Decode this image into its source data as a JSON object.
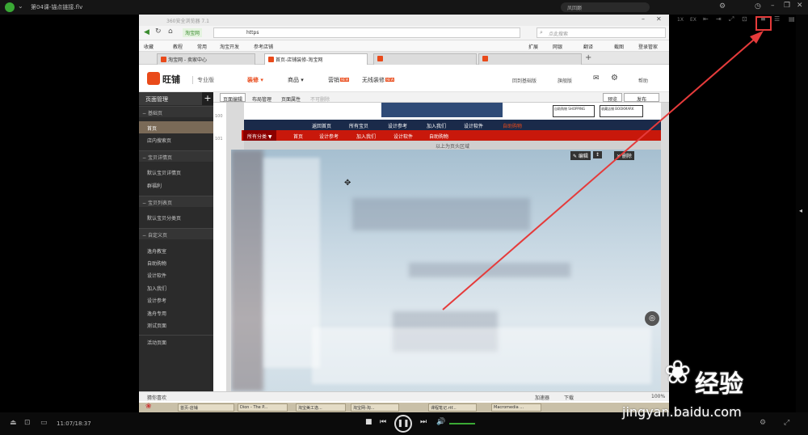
{
  "player": {
    "title": "第04课-锚点链接.flv",
    "search_label": "凤回巅",
    "time": "11:07/18:37"
  },
  "browser": {
    "title": "360安全浏览器 7.1",
    "site_chip": "淘宝网",
    "url": "https",
    "search_placeholder": "点此搜索",
    "favorites": [
      "收藏",
      "教程",
      "常用",
      "淘宝开发",
      "参考店铺"
    ],
    "toolbar_right": [
      "扩展",
      "网银",
      "翻译",
      "截图",
      "登录管家"
    ],
    "tabs": [
      {
        "label": "淘宝网 - 卖家中心",
        "active": false
      },
      {
        "label": "首页-店铺装修-淘宝网",
        "active": true
      },
      {
        "label": "",
        "active": false
      },
      {
        "label": "",
        "active": false
      }
    ]
  },
  "app": {
    "logo": "旺铺",
    "edition": "专业版",
    "nav": [
      {
        "label": "装修",
        "active": true,
        "hot": false
      },
      {
        "label": "商品",
        "active": false,
        "hot": false
      },
      {
        "label": "营销",
        "active": false,
        "hot": true
      },
      {
        "label": "无线装修",
        "active": false,
        "hot": true
      }
    ],
    "hot_badge": "NEW",
    "right_nav": [
      "回到基础版",
      "旗舰版",
      "帮助"
    ]
  },
  "sidebar": {
    "header": "页面管理",
    "groups": [
      {
        "label": "基础页",
        "items": [
          "首页",
          "店内搜索页"
        ]
      },
      {
        "label": "宝贝详情页",
        "items": [
          "默认宝贝详情页",
          "群福利"
        ]
      },
      {
        "label": "宝贝列表页",
        "items": [
          "默认宝贝分类页"
        ]
      },
      {
        "label": "自定义页",
        "items": [
          "逸舟教室",
          "自助购物",
          "设计软件",
          "加入我们",
          "设计参考",
          "逸舟专用",
          "测试页面"
        ]
      }
    ],
    "footer_item": "活动页面"
  },
  "editor": {
    "tabs": [
      "页面编辑",
      "布局管理",
      "页面属性",
      "不可删除"
    ],
    "preview": "预览",
    "publish": "发布",
    "ruler": [
      "100",
      "101"
    ],
    "shop_badges": [
      "自助购物 SHOPPING",
      "收藏店铺 BOOKMARK"
    ],
    "navy_links": [
      "返回首页",
      "所有宝贝",
      "设计参考",
      "加入我们",
      "设计软件",
      "自助购物"
    ],
    "red_links": [
      "所有分类 ▼",
      "首页",
      "设计参考",
      "加入我们",
      "设计软件",
      "自助购物"
    ],
    "region_label": "以上为页头区域",
    "edit_btns": [
      "✎ 编辑",
      "✕ 删除"
    ]
  },
  "statusbar": {
    "left": "猜你喜欢",
    "right": [
      "加速器",
      "下载",
      "100%"
    ]
  },
  "taskbar": [
    "首页-店铺",
    "Dion - The P...",
    "淘宝美工逸...",
    "淘宝网-淘...",
    "课程笔记.rtf...",
    "Macromedia ..."
  ],
  "watermark": {
    "text": "经验",
    "url": "jingyan.baidu.com"
  },
  "colors": {
    "accent": "#e94a1a",
    "annotation": "#e53b3b",
    "navy": "#1a2a4a",
    "red_nav": "#c8180b"
  }
}
